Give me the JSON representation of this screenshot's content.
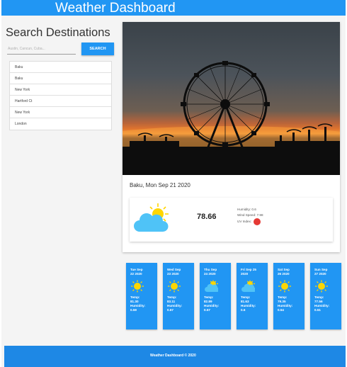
{
  "header": {
    "title": "Weather Dashboard"
  },
  "search": {
    "title": "Search Destinations",
    "placeholder": "Austin, Cancun, Cuba...",
    "button_label": "SEARCH"
  },
  "history": [
    "Baku",
    "Baku",
    "New York",
    "Hartford Ct",
    "New York",
    "London"
  ],
  "current": {
    "city_date": "Baku, Mon Sep 21 2020",
    "temp": "78.66",
    "humidity": "Humidity: 0.6",
    "wind": "Wind Speed: 7.98",
    "uv_label": "UV Index:",
    "uv_color": "#e53935",
    "icon": "partly-cloudy-icon",
    "photo_icon": "ferris-wheel-photo"
  },
  "forecast": [
    {
      "date": "Tue Sep\n22 2020",
      "temp_label": "Temp:",
      "temp": "81.30",
      "hum_label": "Humidity:",
      "humidity": "0.59",
      "icon": "sun-icon"
    },
    {
      "date": "Wed Sep\n23 2020",
      "temp_label": "Temp:",
      "temp": "83.11",
      "hum_label": "Humidity:",
      "humidity": "0.67",
      "icon": "sun-icon"
    },
    {
      "date": "Thu Sep\n24 2020",
      "temp_label": "Temp:",
      "temp": "82.89",
      "hum_label": "Humidity:",
      "humidity": "0.57",
      "icon": "partly-cloudy-icon"
    },
    {
      "date": "Fri Sep 25\n2020",
      "temp_label": "Temp:",
      "temp": "81.63",
      "hum_label": "Humidity:",
      "humidity": "0.6",
      "icon": "partly-cloudy-icon"
    },
    {
      "date": "Sat Sep\n26 2020",
      "temp_label": "Temp:",
      "temp": "79.35",
      "hum_label": "Humidity:",
      "humidity": "0.54",
      "icon": "sun-icon"
    },
    {
      "date": "Sun Sep\n27 2020",
      "temp_label": "Temp:",
      "temp": "77.56",
      "hum_label": "Humidity:",
      "humidity": "0.51",
      "icon": "sun-icon"
    }
  ],
  "footer": {
    "text": "Weather Dashboard © 2020"
  },
  "colors": {
    "primary": "#2196f3",
    "footer": "#1e88e5",
    "sun": "#ffd600",
    "cloud": "#4fc3f7"
  }
}
